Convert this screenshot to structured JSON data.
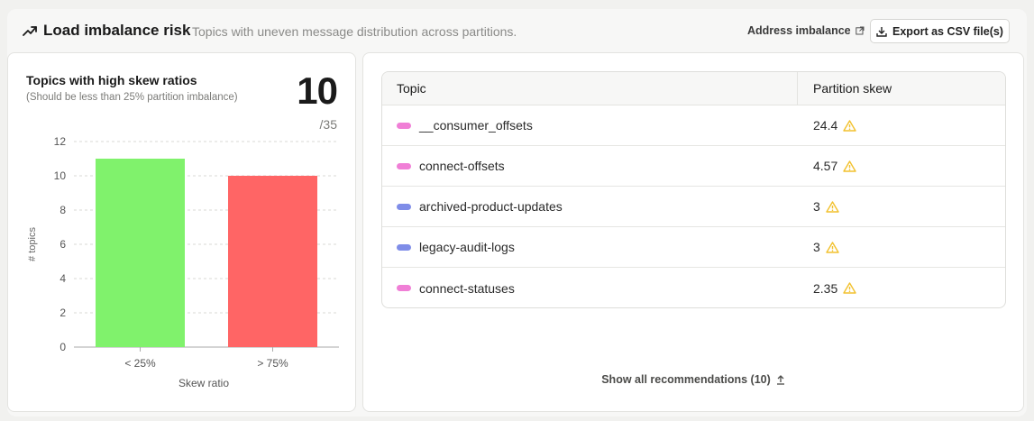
{
  "header": {
    "title": "Load imbalance risk",
    "subtitle": "Topics with uneven message distribution across partitions.",
    "address_label": "Address imbalance",
    "export_label": "Export as CSV file(s)",
    "icons": {
      "trend": "trending-up-icon",
      "external": "external-link-icon",
      "download": "download-icon"
    }
  },
  "kpi": {
    "title": "Topics with high skew ratios",
    "subtitle": "(Should be less than 25% partition imbalance)",
    "value": "10",
    "total": "/35"
  },
  "chart_data": {
    "type": "bar",
    "categories": [
      "< 25%",
      "> 75%"
    ],
    "values": [
      11,
      10
    ],
    "colors": [
      "#80f26c",
      "#ff6565"
    ],
    "ylim": [
      0,
      12
    ],
    "yticks": [
      0,
      2,
      4,
      6,
      8,
      10,
      12
    ],
    "xlabel": "Skew ratio",
    "ylabel": "# topics",
    "grid": true
  },
  "table": {
    "headers": {
      "topic": "Topic",
      "skew": "Partition skew"
    },
    "rows": [
      {
        "topic": "__consumer_offsets",
        "skew": "24.4",
        "color": "#f07fd6"
      },
      {
        "topic": "connect-offsets",
        "skew": "4.57",
        "color": "#f07fd6"
      },
      {
        "topic": "archived-product-updates",
        "skew": "3",
        "color": "#7f8de8"
      },
      {
        "topic": "legacy-audit-logs",
        "skew": "3",
        "color": "#7f8de8"
      },
      {
        "topic": "connect-statuses",
        "skew": "2.35",
        "color": "#f07fd6"
      }
    ],
    "warning_icon": "warning-icon",
    "warning_color": "#f2c12e"
  },
  "footer": {
    "show_all_label": "Show all recommendations (10)"
  }
}
